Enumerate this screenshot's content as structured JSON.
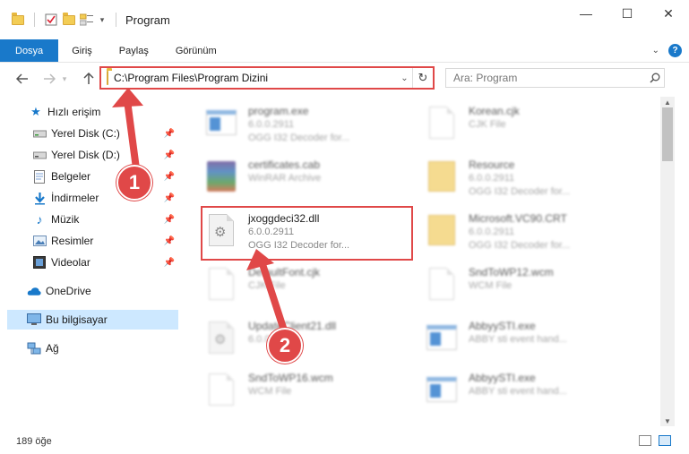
{
  "window": {
    "title": "Program",
    "minimize": "—",
    "maximize": "☐",
    "close": "✕"
  },
  "ribbon": {
    "tabs": [
      {
        "label": "Dosya",
        "active": true
      },
      {
        "label": "Giriş"
      },
      {
        "label": "Paylaş"
      },
      {
        "label": "Görünüm"
      }
    ],
    "help": "?"
  },
  "address": {
    "path": "C:\\Program Files\\Program Dizini",
    "search_placeholder": "Ara: Program"
  },
  "nav": {
    "items": [
      {
        "label": "Hızlı erişim",
        "icon": "star-icon"
      },
      {
        "label": "Yerel Disk (C:)",
        "icon": "drive-icon",
        "pinned": true
      },
      {
        "label": "Yerel Disk (D:)",
        "icon": "drive-icon",
        "pinned": true
      },
      {
        "label": "Belgeler",
        "icon": "documents-icon",
        "pinned": true
      },
      {
        "label": "İndirmeler",
        "icon": "download-icon",
        "pinned": true
      },
      {
        "label": "Müzik",
        "icon": "music-icon",
        "pinned": true
      },
      {
        "label": "Resimler",
        "icon": "pictures-icon",
        "pinned": true
      },
      {
        "label": "Videolar",
        "icon": "videos-icon",
        "pinned": true
      },
      {
        "label": "OneDrive",
        "icon": "cloud-icon"
      },
      {
        "label": "Bu bilgisayar",
        "icon": "computer-icon",
        "selected": true
      },
      {
        "label": "Ağ",
        "icon": "network-icon"
      }
    ]
  },
  "files": [
    {
      "name": "program.exe",
      "line1": "6.0.0.2911",
      "line2": "OGG I32 Decoder for...",
      "icon": "exe-icon",
      "blurred": true
    },
    {
      "name": "Korean.cjk",
      "line1": "CJK File",
      "line2": "",
      "icon": "file-icon",
      "blurred": true
    },
    {
      "name": "certificates.cab",
      "line1": "WinRAR Archive",
      "line2": "",
      "icon": "winrar-icon",
      "blurred": true
    },
    {
      "name": "Resource",
      "line1": "6.0.0.2911",
      "line2": "OGG I32 Decoder for...",
      "icon": "folder-icon",
      "blurred": true
    },
    {
      "name": "jxoggdeci32.dll",
      "line1": "6.0.0.2911",
      "line2": "OGG I32 Decoder for...",
      "icon": "dll-icon",
      "blurred": false,
      "highlighted": true
    },
    {
      "name": "Microsoft.VC90.CRT",
      "line1": "6.0.0.2911",
      "line2": "OGG I32 Decoder for...",
      "icon": "folder-icon",
      "blurred": true
    },
    {
      "name": "DefaultFont.cjk",
      "line1": "CJK File",
      "line2": "",
      "icon": "file-icon",
      "blurred": true
    },
    {
      "name": "SndToWP12.wcm",
      "line1": "WCM File",
      "line2": "",
      "icon": "file-icon",
      "blurred": true
    },
    {
      "name": "UpdateClient21.dll",
      "line1": "6.0.0.2911",
      "line2": "",
      "icon": "dll-icon",
      "blurred": true
    },
    {
      "name": "AbbyySTI.exe",
      "line1": "ABBY sti event hand...",
      "line2": "",
      "icon": "exe-icon",
      "blurred": true
    },
    {
      "name": "SndToWP16.wcm",
      "line1": "WCM File",
      "line2": "",
      "icon": "file-icon",
      "blurred": true
    },
    {
      "name": "AbbyySTI.exe",
      "line1": "ABBY sti event hand...",
      "line2": "",
      "icon": "exe-icon",
      "blurred": true
    }
  ],
  "status": {
    "item_count": "189 öğe"
  },
  "annotations": {
    "badge1": "1",
    "badge2": "2",
    "accent": "#e04848"
  },
  "colors": {
    "accent_blue": "#1979ca",
    "selected_bg": "#cde8ff"
  }
}
